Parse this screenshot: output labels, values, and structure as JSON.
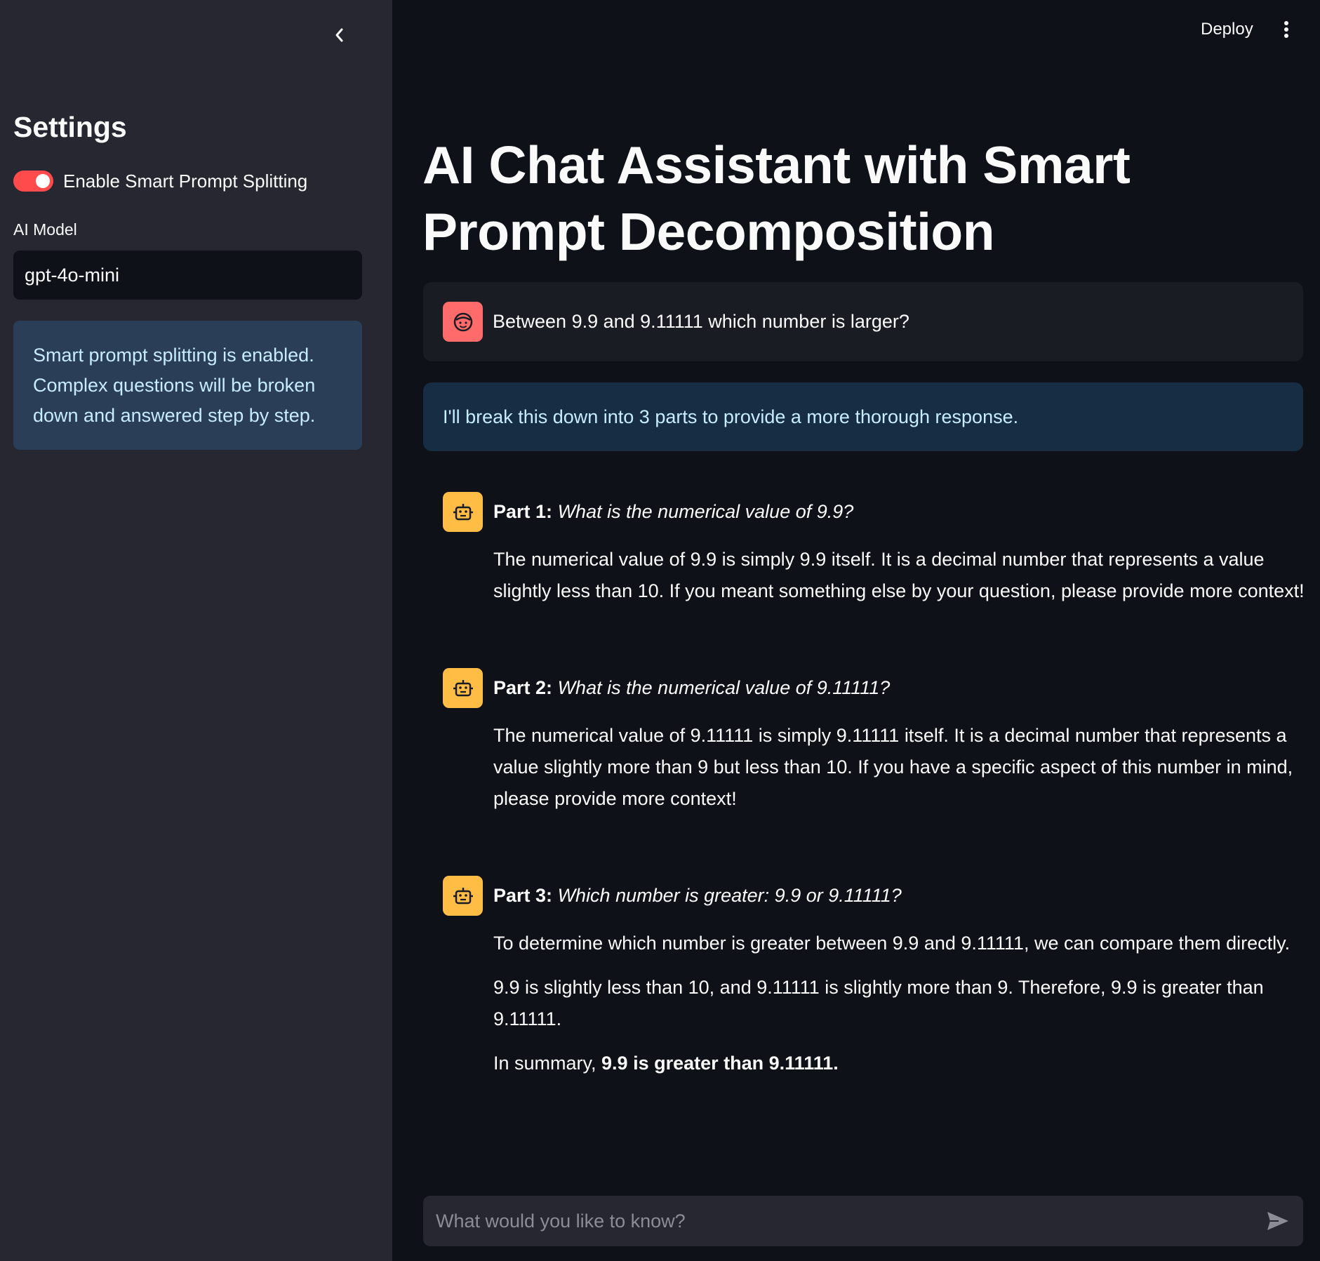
{
  "sidebar": {
    "title": "Settings",
    "toggle_label": "Enable Smart Prompt Splitting",
    "toggle_on": true,
    "model_label": "AI Model",
    "model_value": "gpt-4o-mini",
    "info_text": "Smart prompt splitting is enabled. Complex questions will be broken down and answered step by step."
  },
  "header": {
    "deploy_label": "Deploy"
  },
  "main": {
    "title": "AI Chat Assistant with Smart Prompt Decomposition",
    "user_message": "Between 9.9 and 9.11111 which number is larger?",
    "breakdown_notice": "I'll break this down into 3 parts to provide a more thorough response.",
    "parts": [
      {
        "label": "Part 1:",
        "question": "What is the numerical value of 9.9?",
        "paragraphs": [
          "The numerical value of 9.9 is simply 9.9 itself. It is a decimal number that represents a value slightly less than 10. If you meant something else by your question, please provide more context!"
        ]
      },
      {
        "label": "Part 2:",
        "question": "What is the numerical value of 9.11111?",
        "paragraphs": [
          "The numerical value of 9.11111 is simply 9.11111 itself. It is a decimal number that represents a value slightly more than 9 but less than 10. If you have a specific aspect of this number in mind, please provide more context!"
        ]
      },
      {
        "label": "Part 3:",
        "question": "Which number is greater: 9.9 or 9.11111?",
        "paragraphs": [
          "To determine which number is greater between 9.9 and 9.11111, we can compare them directly.",
          "9.9 is slightly less than 10, and 9.11111 is slightly more than 9. Therefore, 9.9 is greater than 9.11111."
        ],
        "summary_prefix": "In summary, ",
        "summary_bold": "9.9 is greater than 9.11111."
      }
    ]
  },
  "chat_input": {
    "placeholder": "What would you like to know?"
  },
  "colors": {
    "accent": "#ff4b4b",
    "user_avatar": "#ff6b6b",
    "bot_avatar": "#ffbd45",
    "info_text": "#c7ebff"
  }
}
